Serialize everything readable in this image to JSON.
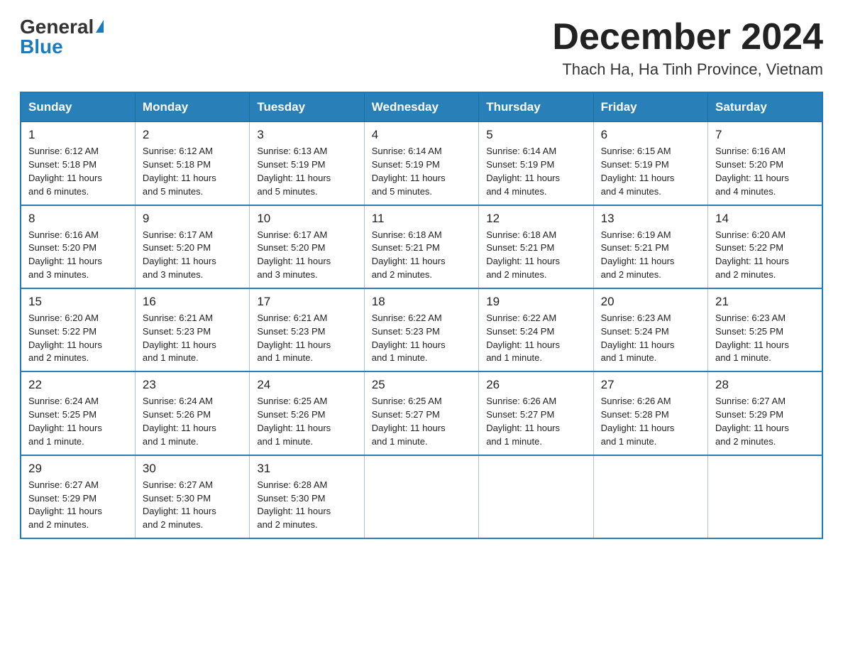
{
  "logo": {
    "general": "General",
    "blue": "Blue"
  },
  "title": "December 2024",
  "subtitle": "Thach Ha, Ha Tinh Province, Vietnam",
  "headers": [
    "Sunday",
    "Monday",
    "Tuesday",
    "Wednesday",
    "Thursday",
    "Friday",
    "Saturday"
  ],
  "weeks": [
    [
      {
        "day": "1",
        "info": "Sunrise: 6:12 AM\nSunset: 5:18 PM\nDaylight: 11 hours\nand 6 minutes."
      },
      {
        "day": "2",
        "info": "Sunrise: 6:12 AM\nSunset: 5:18 PM\nDaylight: 11 hours\nand 5 minutes."
      },
      {
        "day": "3",
        "info": "Sunrise: 6:13 AM\nSunset: 5:19 PM\nDaylight: 11 hours\nand 5 minutes."
      },
      {
        "day": "4",
        "info": "Sunrise: 6:14 AM\nSunset: 5:19 PM\nDaylight: 11 hours\nand 5 minutes."
      },
      {
        "day": "5",
        "info": "Sunrise: 6:14 AM\nSunset: 5:19 PM\nDaylight: 11 hours\nand 4 minutes."
      },
      {
        "day": "6",
        "info": "Sunrise: 6:15 AM\nSunset: 5:19 PM\nDaylight: 11 hours\nand 4 minutes."
      },
      {
        "day": "7",
        "info": "Sunrise: 6:16 AM\nSunset: 5:20 PM\nDaylight: 11 hours\nand 4 minutes."
      }
    ],
    [
      {
        "day": "8",
        "info": "Sunrise: 6:16 AM\nSunset: 5:20 PM\nDaylight: 11 hours\nand 3 minutes."
      },
      {
        "day": "9",
        "info": "Sunrise: 6:17 AM\nSunset: 5:20 PM\nDaylight: 11 hours\nand 3 minutes."
      },
      {
        "day": "10",
        "info": "Sunrise: 6:17 AM\nSunset: 5:20 PM\nDaylight: 11 hours\nand 3 minutes."
      },
      {
        "day": "11",
        "info": "Sunrise: 6:18 AM\nSunset: 5:21 PM\nDaylight: 11 hours\nand 2 minutes."
      },
      {
        "day": "12",
        "info": "Sunrise: 6:18 AM\nSunset: 5:21 PM\nDaylight: 11 hours\nand 2 minutes."
      },
      {
        "day": "13",
        "info": "Sunrise: 6:19 AM\nSunset: 5:21 PM\nDaylight: 11 hours\nand 2 minutes."
      },
      {
        "day": "14",
        "info": "Sunrise: 6:20 AM\nSunset: 5:22 PM\nDaylight: 11 hours\nand 2 minutes."
      }
    ],
    [
      {
        "day": "15",
        "info": "Sunrise: 6:20 AM\nSunset: 5:22 PM\nDaylight: 11 hours\nand 2 minutes."
      },
      {
        "day": "16",
        "info": "Sunrise: 6:21 AM\nSunset: 5:23 PM\nDaylight: 11 hours\nand 1 minute."
      },
      {
        "day": "17",
        "info": "Sunrise: 6:21 AM\nSunset: 5:23 PM\nDaylight: 11 hours\nand 1 minute."
      },
      {
        "day": "18",
        "info": "Sunrise: 6:22 AM\nSunset: 5:23 PM\nDaylight: 11 hours\nand 1 minute."
      },
      {
        "day": "19",
        "info": "Sunrise: 6:22 AM\nSunset: 5:24 PM\nDaylight: 11 hours\nand 1 minute."
      },
      {
        "day": "20",
        "info": "Sunrise: 6:23 AM\nSunset: 5:24 PM\nDaylight: 11 hours\nand 1 minute."
      },
      {
        "day": "21",
        "info": "Sunrise: 6:23 AM\nSunset: 5:25 PM\nDaylight: 11 hours\nand 1 minute."
      }
    ],
    [
      {
        "day": "22",
        "info": "Sunrise: 6:24 AM\nSunset: 5:25 PM\nDaylight: 11 hours\nand 1 minute."
      },
      {
        "day": "23",
        "info": "Sunrise: 6:24 AM\nSunset: 5:26 PM\nDaylight: 11 hours\nand 1 minute."
      },
      {
        "day": "24",
        "info": "Sunrise: 6:25 AM\nSunset: 5:26 PM\nDaylight: 11 hours\nand 1 minute."
      },
      {
        "day": "25",
        "info": "Sunrise: 6:25 AM\nSunset: 5:27 PM\nDaylight: 11 hours\nand 1 minute."
      },
      {
        "day": "26",
        "info": "Sunrise: 6:26 AM\nSunset: 5:27 PM\nDaylight: 11 hours\nand 1 minute."
      },
      {
        "day": "27",
        "info": "Sunrise: 6:26 AM\nSunset: 5:28 PM\nDaylight: 11 hours\nand 1 minute."
      },
      {
        "day": "28",
        "info": "Sunrise: 6:27 AM\nSunset: 5:29 PM\nDaylight: 11 hours\nand 2 minutes."
      }
    ],
    [
      {
        "day": "29",
        "info": "Sunrise: 6:27 AM\nSunset: 5:29 PM\nDaylight: 11 hours\nand 2 minutes."
      },
      {
        "day": "30",
        "info": "Sunrise: 6:27 AM\nSunset: 5:30 PM\nDaylight: 11 hours\nand 2 minutes."
      },
      {
        "day": "31",
        "info": "Sunrise: 6:28 AM\nSunset: 5:30 PM\nDaylight: 11 hours\nand 2 minutes."
      },
      {
        "day": "",
        "info": ""
      },
      {
        "day": "",
        "info": ""
      },
      {
        "day": "",
        "info": ""
      },
      {
        "day": "",
        "info": ""
      }
    ]
  ]
}
